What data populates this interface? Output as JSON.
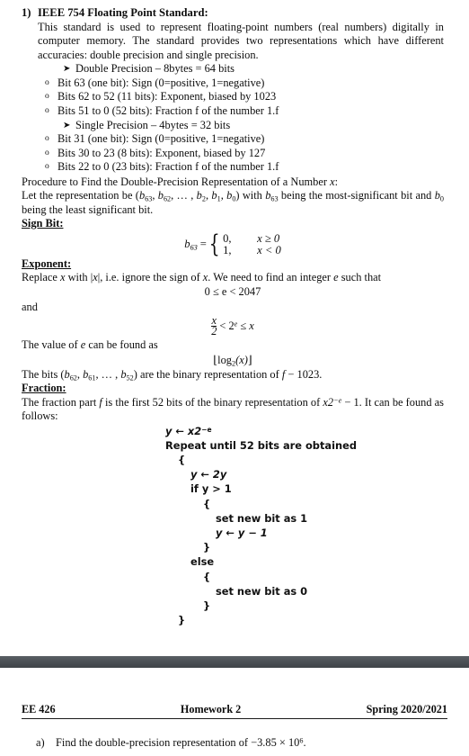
{
  "section": {
    "number": "1)",
    "title": "IEEE 754 Floating Point Standard:",
    "intro": "This standard is used to represent floating-point numbers (real numbers) digitally in computer memory. The standard provides two representations which have different accuracies: double precision and single precision."
  },
  "precision": {
    "double": {
      "label": "Double Precision – 8bytes = 64 bits",
      "bits": [
        "Bit 63 (one bit): Sign (0=positive, 1=negative)",
        "Bits 62 to 52 (11 bits): Exponent, biased by 1023",
        "Bits 51 to 0 (52 bits): Fraction f of the number 1.f"
      ]
    },
    "single": {
      "label": "Single Precision – 4bytes = 32 bits",
      "bits": [
        "Bit 31 (one bit): Sign (0=positive, 1=negative)",
        "Bits 30 to 23 (8 bits): Exponent, biased by 127",
        "Bits 22 to 0 (23 bits): Fraction f of the number 1.f"
      ]
    },
    "bullet_arrow": "arrow-bullet-icon",
    "bullet_circle": "circle-bullet-icon"
  },
  "procedure": {
    "heading": "Procedure to Find the Double-Precision Representation of a Number",
    "heading_var": "x",
    "heading_colon": ":",
    "representation_line": {
      "p1": "Let the representation be (",
      "b1": "b",
      "s1": "63",
      "sep1": ", ",
      "b2": "b",
      "s2": "62",
      "sep2": ", … , ",
      "b3": "b",
      "s3": "2",
      "sep3": ", ",
      "b4": "b",
      "s4": "1",
      "sep4": ", ",
      "b5": "b",
      "s5": "0",
      "p2": ") with ",
      "b6": "b",
      "s6": "63",
      "p3": " being the most-significant bit and ",
      "b7": "b",
      "s7": "0",
      "p4": " being the least significant bit."
    }
  },
  "sign_bit": {
    "heading": "Sign Bit:",
    "lhs": "b",
    "lhs_sub": "63",
    "equals": "=",
    "case1_value": "0,",
    "case1_cond": "x ≥ 0",
    "case2_value": "1,",
    "case2_cond": "x < 0"
  },
  "exponent": {
    "heading": "Exponent:",
    "text_a": "Replace ",
    "var_x": "x",
    "text_b": " with |",
    "var_x2": "x",
    "text_c": "|, i.e. ignore the sign of ",
    "var_x3": "x",
    "text_d": ". We need to find an integer ",
    "var_e": "e",
    "text_e": " such that",
    "range_eq": "0 ≤ e < 2047",
    "and_word": "and",
    "frac_num": "x",
    "frac_den": "2",
    "frac_rhs": "< 2",
    "frac_rhs_sup": "e",
    "frac_rhs_tail": " ≤ x",
    "value_line": "The value of e can be found as",
    "value_line_pre": "The value of ",
    "value_line_var": "e",
    "value_line_post": " can be found as",
    "floor_eq": "⌊log₂(x)⌋",
    "floor_open": "⌊",
    "floor_log": "log",
    "floor_sub": "2",
    "floor_arg": "(x)",
    "floor_close": "⌋",
    "bits_line": {
      "p1": "The bits (",
      "b1": "b",
      "s1": "62",
      "sep1": ", ",
      "b2": "b",
      "s2": "61",
      "sep2": ", … , ",
      "b3": "b",
      "s3": "52",
      "p2": ") are the binary representation of ",
      "var_f": "f",
      "p3": " − 1023."
    }
  },
  "fraction": {
    "heading": "Fraction:",
    "p1": "The fraction part ",
    "var_f": "f",
    "p2": " is the first 52 bits of the binary representation of ",
    "expr": "x2",
    "expr_sup": "−e",
    "p3": " − 1. It can be found as follows:"
  },
  "pseudocode": {
    "lines": [
      {
        "indent": 0,
        "text": "y ← x2",
        "sup": "−e",
        "italic": true
      },
      {
        "indent": 0,
        "text": "Repeat until 52 bits are obtained"
      },
      {
        "indent": 1,
        "text": "{"
      },
      {
        "indent": 2,
        "text": "y ← 2y",
        "italic": true
      },
      {
        "indent": 2,
        "text": "if y > 1"
      },
      {
        "indent": 3,
        "text": "{"
      },
      {
        "indent": 4,
        "text": "set new bit as 1"
      },
      {
        "indent": 4,
        "text": "y ← y − 1",
        "italic": true
      },
      {
        "indent": 3,
        "text": "}"
      },
      {
        "indent": 2,
        "text": "else"
      },
      {
        "indent": 3,
        "text": "{"
      },
      {
        "indent": 4,
        "text": "set new bit as 0"
      },
      {
        "indent": 3,
        "text": "}"
      },
      {
        "indent": 1,
        "text": "}"
      }
    ]
  },
  "sheet_header": {
    "course": "EE 426",
    "assignment": "Homework 2",
    "term": "Spring 2020/2021"
  },
  "sub_question": {
    "label": "a)",
    "text_pre": "Find the double-precision representation of −3.85 × 10",
    "sup": "6",
    "text_post": "."
  },
  "colors": {
    "page_break_bar": "#4c5156",
    "text": "#0d0d0d",
    "rule": "#1a1a1a"
  }
}
